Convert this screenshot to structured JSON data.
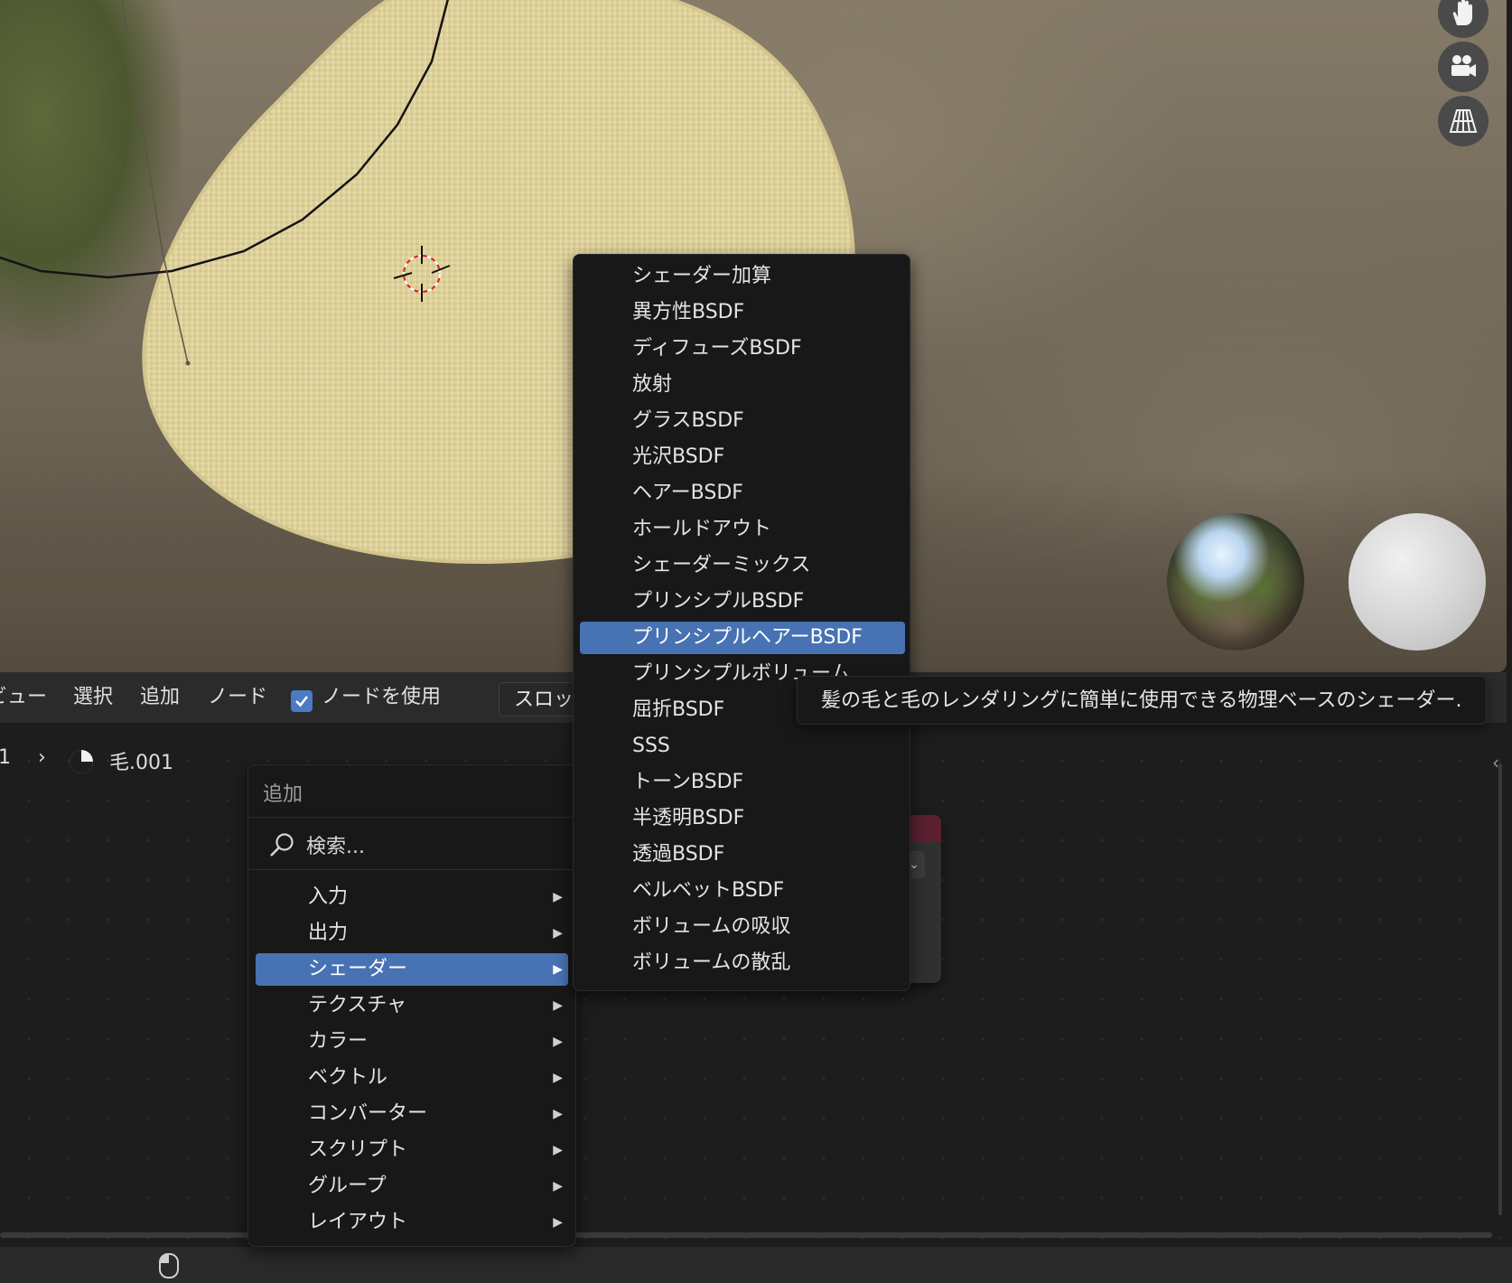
{
  "header": {
    "view_label": "ビュー",
    "select_label": "選択",
    "add_label": "追加",
    "node_label": "ノード",
    "use_nodes_label": "ノードを使用",
    "slot_label": "スロット"
  },
  "breadcrumb": {
    "prefix": "1",
    "separator": "›",
    "material_name": "毛.001"
  },
  "add_menu": {
    "title": "追加",
    "search_placeholder": "検索...",
    "items": [
      {
        "label": "入力"
      },
      {
        "label": "出力"
      },
      {
        "label": "シェーダー",
        "active": true
      },
      {
        "label": "テクスチャ"
      },
      {
        "label": "カラー"
      },
      {
        "label": "ベクトル"
      },
      {
        "label": "コンバーター"
      },
      {
        "label": "スクリプト"
      },
      {
        "label": "グループ"
      },
      {
        "label": "レイアウト"
      }
    ]
  },
  "shader_menu": {
    "items": [
      {
        "label": "シェーダー加算"
      },
      {
        "label": "異方性BSDF"
      },
      {
        "label": "ディフューズBSDF"
      },
      {
        "label": "放射"
      },
      {
        "label": "グラスBSDF"
      },
      {
        "label": "光沢BSDF"
      },
      {
        "label": "ヘアーBSDF"
      },
      {
        "label": "ホールドアウト"
      },
      {
        "label": "シェーダーミックス"
      },
      {
        "label": "プリンシプルBSDF"
      },
      {
        "label": "プリンシプルヘアーBSDF",
        "active": true
      },
      {
        "label": "プリンシプルボリューム"
      },
      {
        "label": "屈折BSDF"
      },
      {
        "label": "SSS"
      },
      {
        "label": "トーンBSDF"
      },
      {
        "label": "半透明BSDF"
      },
      {
        "label": "透過BSDF"
      },
      {
        "label": "ベルベットBSDF"
      },
      {
        "label": "ボリュームの吸収"
      },
      {
        "label": "ボリュームの散乱"
      }
    ]
  },
  "tooltip": {
    "text": "髪の毛と毛のレンダリングに簡単に使用できる物理ベースのシェーダー."
  },
  "icons": {
    "hand": "hand-icon",
    "camera": "camera-icon",
    "perspective": "perspective-grid-icon",
    "search": "search-icon",
    "submenu_arrow": "triangle-right-icon",
    "material": "material-icon",
    "mouse": "mouse-icon",
    "checkbox": "checkmark-icon"
  },
  "colors": {
    "accent": "#4772b3",
    "menu_bg": "#181818",
    "header_bg": "#2b2b2b",
    "canvas_bg": "#1d1d1d",
    "fur": "#e3d8a6"
  }
}
